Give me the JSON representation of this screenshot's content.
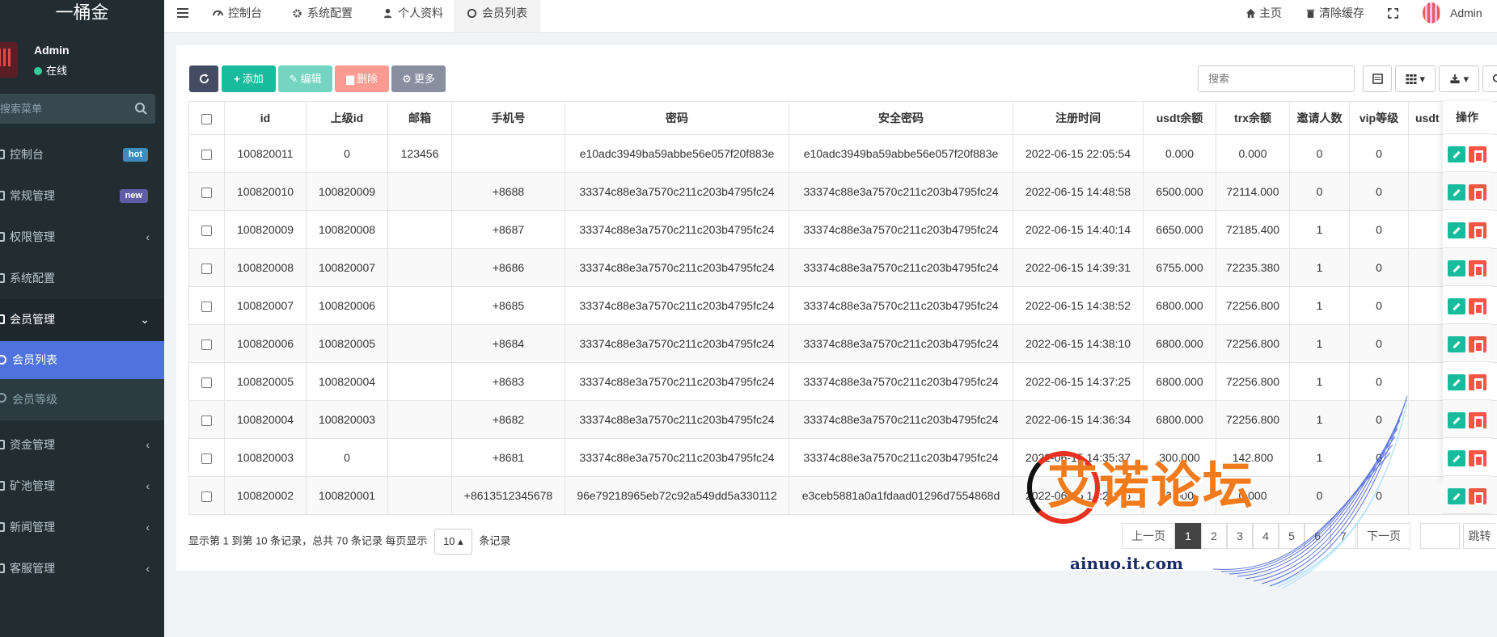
{
  "sidebar": {
    "logo": "一桶金",
    "user": {
      "name": "Admin",
      "status": "在线"
    },
    "search_placeholder": "搜索菜单",
    "menu": [
      {
        "label": "控制台",
        "badge": "hot",
        "badge_color": "#3c8dbc"
      },
      {
        "label": "常规管理",
        "badge": "new",
        "badge_color": "#605ca8"
      },
      {
        "label": "权限管理",
        "chevron": "‹"
      },
      {
        "label": "系统配置"
      },
      {
        "label": "会员管理",
        "chevron": "⌄"
      }
    ],
    "submenu": [
      {
        "label": "会员列表"
      },
      {
        "label": "会员等级"
      }
    ],
    "menu_bottom": [
      {
        "label": "资金管理",
        "chevron": "‹"
      },
      {
        "label": "矿池管理",
        "chevron": "‹"
      },
      {
        "label": "新闻管理",
        "chevron": "‹"
      },
      {
        "label": "客服管理",
        "chevron": "‹"
      }
    ]
  },
  "topbar": {
    "tabs": [
      {
        "label": "控制台",
        "icon": "dashboard-icon"
      },
      {
        "label": "系统配置",
        "icon": "gear-icon"
      },
      {
        "label": "个人资料",
        "icon": "user-icon"
      },
      {
        "label": "会员列表",
        "icon": "circle-icon"
      }
    ],
    "home": "主页",
    "clear_cache": "清除缓存",
    "user": "Admin"
  },
  "toolbar": {
    "add": "添加",
    "edit": "编辑",
    "delete": "删除",
    "more": "更多",
    "search_placeholder": "搜索"
  },
  "table": {
    "headers": [
      "id",
      "上级id",
      "邮箱",
      "手机号",
      "密码",
      "安全密码",
      "注册时间",
      "usdt余额",
      "trx余额",
      "邀请人数",
      "vip等级",
      "usdt"
    ],
    "op_header": "操作",
    "rows": [
      [
        "100820011",
        "0",
        "123456",
        "",
        "e10adc3949ba59abbe56e057f20f883e",
        "e10adc3949ba59abbe56e057f20f883e",
        "2022-06-15 22:05:54",
        "0.000",
        "0.000",
        "0",
        "0"
      ],
      [
        "100820010",
        "100820009",
        "",
        "+8688",
        "33374c88e3a7570c211c203b4795fc24",
        "33374c88e3a7570c211c203b4795fc24",
        "2022-06-15 14:48:58",
        "6500.000",
        "72114.000",
        "0",
        "0"
      ],
      [
        "100820009",
        "100820008",
        "",
        "+8687",
        "33374c88e3a7570c211c203b4795fc24",
        "33374c88e3a7570c211c203b4795fc24",
        "2022-06-15 14:40:14",
        "6650.000",
        "72185.400",
        "1",
        "0"
      ],
      [
        "100820008",
        "100820007",
        "",
        "+8686",
        "33374c88e3a7570c211c203b4795fc24",
        "33374c88e3a7570c211c203b4795fc24",
        "2022-06-15 14:39:31",
        "6755.000",
        "72235.380",
        "1",
        "0"
      ],
      [
        "100820007",
        "100820006",
        "",
        "+8685",
        "33374c88e3a7570c211c203b4795fc24",
        "33374c88e3a7570c211c203b4795fc24",
        "2022-06-15 14:38:52",
        "6800.000",
        "72256.800",
        "1",
        "0"
      ],
      [
        "100820006",
        "100820005",
        "",
        "+8684",
        "33374c88e3a7570c211c203b4795fc24",
        "33374c88e3a7570c211c203b4795fc24",
        "2022-06-15 14:38:10",
        "6800.000",
        "72256.800",
        "1",
        "0"
      ],
      [
        "100820005",
        "100820004",
        "",
        "+8683",
        "33374c88e3a7570c211c203b4795fc24",
        "33374c88e3a7570c211c203b4795fc24",
        "2022-06-15 14:37:25",
        "6800.000",
        "72256.800",
        "1",
        "0"
      ],
      [
        "100820004",
        "100820003",
        "",
        "+8682",
        "33374c88e3a7570c211c203b4795fc24",
        "33374c88e3a7570c211c203b4795fc24",
        "2022-06-15 14:36:34",
        "6800.000",
        "72256.800",
        "1",
        "0"
      ],
      [
        "100820003",
        "0",
        "",
        "+8681",
        "33374c88e3a7570c211c203b4795fc24",
        "33374c88e3a7570c211c203b4795fc24",
        "2022-06-15 14:35:37",
        "300.000",
        "142.800",
        "1",
        "0"
      ],
      [
        "100820002",
        "100820001",
        "",
        "+8613512345678",
        "96e79218965eb72c92a549dd5a330112",
        "e3ceb5881a0a1fdaad01296d7554868d",
        "2022-06-15 14:24:46",
        "0.000",
        "0.000",
        "0",
        "0"
      ]
    ]
  },
  "pager": {
    "info_prefix": "显示第 1 到第 10 条记录，总共 70 条记录 每页显示",
    "page_size": "10",
    "info_suffix": "条记录",
    "prev": "上一页",
    "pages": [
      "1",
      "2",
      "3",
      "4",
      "5",
      "6",
      "7"
    ],
    "next": "下一页",
    "jump": "跳转"
  },
  "watermark": {
    "text": "艾诺论坛",
    "url": "ainuo.it.com"
  },
  "colors": {
    "sidebar_bg": "#222d32",
    "active_menu": "#4e73df",
    "success": "#18bc9c",
    "danger": "#f75444",
    "primary_dark": "#444c63"
  }
}
